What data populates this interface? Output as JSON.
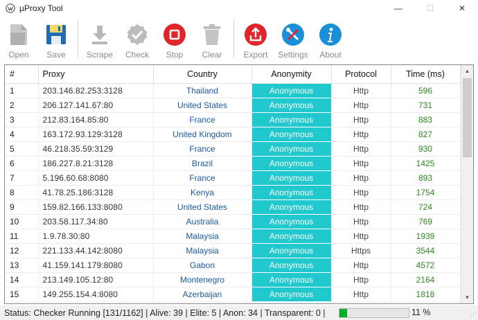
{
  "window": {
    "title": "µProxy Tool",
    "minimize": "—",
    "maximize": "☐",
    "close": "✕"
  },
  "toolbar": {
    "open": "Open",
    "save": "Save",
    "scrape": "Scrape",
    "check": "Check",
    "stop": "Stop",
    "clear": "Clear",
    "export": "Export",
    "settings": "Settings",
    "about": "About"
  },
  "colors": {
    "anonymity_bg": "#21c9cf",
    "country_text": "#1a5aa6",
    "time_text": "#2c8a1f",
    "stop_red": "#e0262b",
    "export_red": "#e0262b",
    "settings_blue": "#1a8fd8",
    "about_blue": "#1a8fd8"
  },
  "table": {
    "headers": [
      "#",
      "Proxy",
      "Country",
      "Anonymity",
      "Protocol",
      "Time (ms)"
    ],
    "rows": [
      {
        "num": "1",
        "proxy": "203.146.82.253:3128",
        "country": "Thailand",
        "anon": "Anonymous",
        "proto": "Http",
        "time": "596"
      },
      {
        "num": "2",
        "proxy": "206.127.141.67:80",
        "country": "United States",
        "anon": "Anonymous",
        "proto": "Http",
        "time": "731"
      },
      {
        "num": "3",
        "proxy": "212.83.164.85:80",
        "country": "France",
        "anon": "Anonymous",
        "proto": "Http",
        "time": "883"
      },
      {
        "num": "4",
        "proxy": "163.172.93.129:3128",
        "country": "United Kingdom",
        "anon": "Anonymous",
        "proto": "Http",
        "time": "827"
      },
      {
        "num": "5",
        "proxy": "46.218.35.59:3129",
        "country": "France",
        "anon": "Anonymous",
        "proto": "Http",
        "time": "930"
      },
      {
        "num": "6",
        "proxy": "186.227.8.21:3128",
        "country": "Brazil",
        "anon": "Anonymous",
        "proto": "Http",
        "time": "1425"
      },
      {
        "num": "7",
        "proxy": "5.196.60.68:8080",
        "country": "France",
        "anon": "Anonymous",
        "proto": "Http",
        "time": "893"
      },
      {
        "num": "8",
        "proxy": "41.78.25.186:3128",
        "country": "Kenya",
        "anon": "Anonymous",
        "proto": "Http",
        "time": "1754"
      },
      {
        "num": "9",
        "proxy": "159.82.166.133:8080",
        "country": "United States",
        "anon": "Anonymous",
        "proto": "Http",
        "time": "724"
      },
      {
        "num": "10",
        "proxy": "203.58.117.34:80",
        "country": "Australia",
        "anon": "Anonymous",
        "proto": "Http",
        "time": "769"
      },
      {
        "num": "11",
        "proxy": "1.9.78.30:80",
        "country": "Malaysia",
        "anon": "Anonymous",
        "proto": "Http",
        "time": "1939"
      },
      {
        "num": "12",
        "proxy": "221.133.44.142:8080",
        "country": "Malaysia",
        "anon": "Anonymous",
        "proto": "Https",
        "time": "3544"
      },
      {
        "num": "13",
        "proxy": "41.159.141.179:8080",
        "country": "Gabon",
        "anon": "Anonymous",
        "proto": "Http",
        "time": "4572"
      },
      {
        "num": "14",
        "proxy": "213.149.105.12:80",
        "country": "Montenegro",
        "anon": "Anonymous",
        "proto": "Http",
        "time": "2164"
      },
      {
        "num": "15",
        "proxy": "149.255.154.4:8080",
        "country": "Azerbaijan",
        "anon": "Anonymous",
        "proto": "Http",
        "time": "1818"
      }
    ]
  },
  "status": {
    "text": "Status: Checker Running [131/1162] | Alive: 39 | Elite: 5 | Anon: 34 | Transparent: 0 |",
    "progress_percent": 11,
    "percent_label": "11 %"
  }
}
